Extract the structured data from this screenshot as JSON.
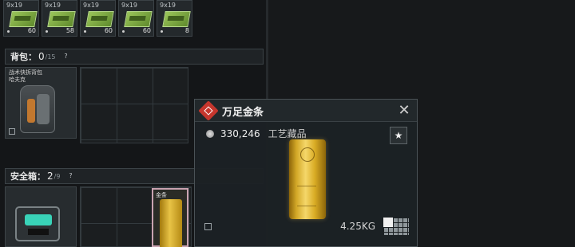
{
  "ammo_slots": [
    {
      "caliber": "9x19",
      "count": "60"
    },
    {
      "caliber": "9x19",
      "count": "58"
    },
    {
      "caliber": "9x19",
      "count": "60"
    },
    {
      "caliber": "9x19",
      "count": "60"
    },
    {
      "caliber": "9x19",
      "count": "8"
    }
  ],
  "backpack_section": {
    "title": "背包：",
    "current": "0",
    "max": "/15",
    "help": "?"
  },
  "backpack_item": {
    "name_line1": "战术快拆背包",
    "name_line2": "哈夫克"
  },
  "safebox_section": {
    "title": "安全箱：",
    "current": "2",
    "max": "/9",
    "help": "?"
  },
  "inventory_gold": {
    "name": "金条"
  },
  "tooltip": {
    "title": "万足金条",
    "price": "330,246",
    "category": "工艺藏品",
    "weight": "4.25KG",
    "close_symbol": "✕",
    "favorite_symbol": "★"
  },
  "colors": {
    "accent_red": "#c6362d",
    "gold": "#e8c346",
    "safe_teal": "#39d3b8",
    "ammo_green": "#9bc65a"
  }
}
